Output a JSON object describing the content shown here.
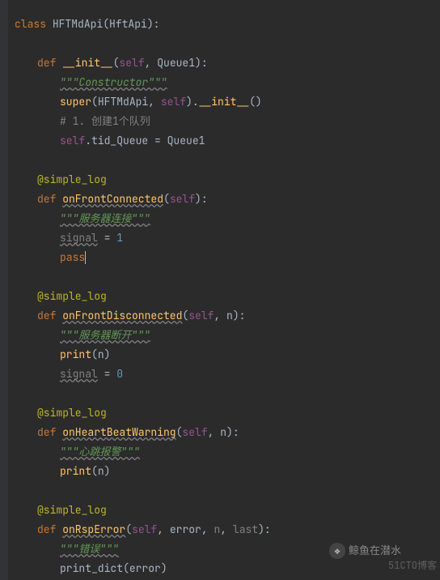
{
  "code": {
    "line1_kw": "class ",
    "line1_cls": "HFTMdApi",
    "line1_paren_open": "(",
    "line1_base": "HftApi",
    "line1_close": "):",
    "init_kw": "def ",
    "init_name": "__init__",
    "init_sig_open": "(",
    "init_self": "self",
    "init_c1": ", ",
    "init_arg1": "Queue1",
    "init_sig_close": "):",
    "init_doc": "\"\"\"Constructor\"\"\"",
    "init_super": "super",
    "init_super_args_open": "(",
    "init_super_cls": "HFTMdApi",
    "init_super_c": ", ",
    "init_super_self": "self",
    "init_super_close": ").",
    "init_super_call": "__init__",
    "init_super_paren": "()",
    "init_comment": "# 1. 创建1个队列",
    "init_assign_self": "self",
    "init_assign_dot": ".tid_Queue ",
    "init_assign_eq": "= ",
    "init_assign_val": "Queue1",
    "dec": "@simple_log",
    "fc_kw": "def ",
    "fc_name": "onFrontConnected",
    "fc_sig_open": "(",
    "fc_self": "self",
    "fc_sig_close": "):",
    "fc_doc": "\"\"\"服务器连接\"\"\"",
    "fc_sig_var": "signal",
    "fc_sig_eq": " = ",
    "fc_sig_num": "1",
    "fc_pass": "pass",
    "fd_kw": "def ",
    "fd_name": "onFrontDisconnected",
    "fd_sig_open": "(",
    "fd_self": "self",
    "fd_c1": ", ",
    "fd_arg": "n",
    "fd_sig_close": "):",
    "fd_doc": "\"\"\"服务器断开\"\"\"",
    "fd_print": "print",
    "fd_print_open": "(",
    "fd_print_arg": "n",
    "fd_print_close": ")",
    "fd_sig_var": "signal",
    "fd_sig_eq": " = ",
    "fd_sig_num": "0",
    "hb_kw": "def ",
    "hb_name": "onHeartBeatWarning",
    "hb_sig_open": "(",
    "hb_self": "self",
    "hb_c1": ", ",
    "hb_arg": "n",
    "hb_sig_close": "):",
    "hb_doc": "\"\"\"心跳报警\"\"\"",
    "hb_print": "print",
    "hb_print_open": "(",
    "hb_print_arg": "n",
    "hb_print_close": ")",
    "re_kw": "def ",
    "re_name": "onRspError",
    "re_sig_open": "(",
    "re_self": "self",
    "re_c1": ", ",
    "re_arg1": "error",
    "re_c2": ", ",
    "re_arg2": "n",
    "re_c3": ", ",
    "re_arg3": "last",
    "re_sig_close": "):",
    "re_doc": "\"\"\"错误\"\"\"",
    "re_call": "print_dict",
    "re_call_open": "(",
    "re_call_arg": "error",
    "re_call_close": ")"
  },
  "watermark1": "鲸鱼在潜水",
  "watermark2": "51CTO博客"
}
